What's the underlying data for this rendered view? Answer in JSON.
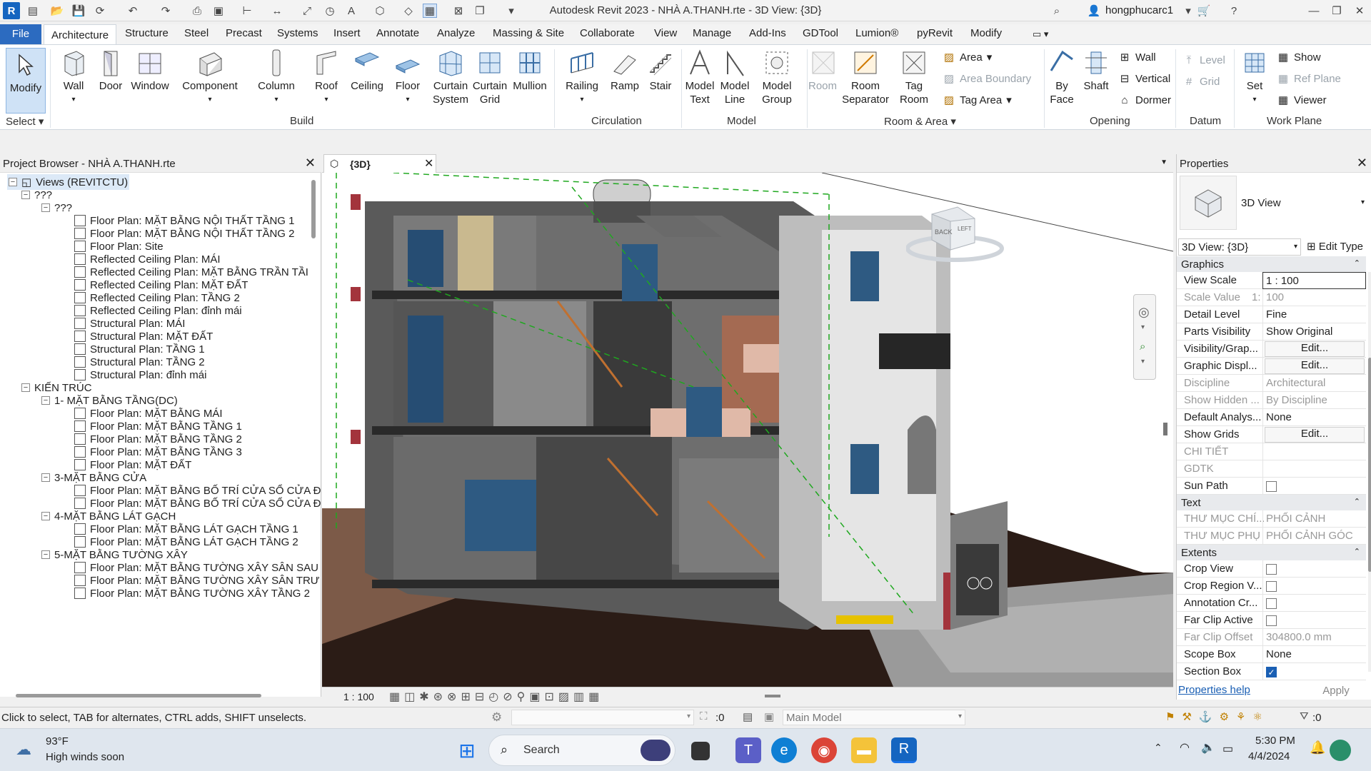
{
  "window": {
    "title": "Autodesk Revit 2023 - NHÀ A.THANH.rte - 3D View: {3D}",
    "user": "hongphucarc1",
    "logo": "R"
  },
  "menu_tabs": [
    "File",
    "Architecture",
    "Structure",
    "Steel",
    "Precast",
    "Systems",
    "Insert",
    "Annotate",
    "Analyze",
    "Massing & Site",
    "Collaborate",
    "View",
    "Manage",
    "Add-Ins",
    "GDTool",
    "Lumion®",
    "pyRevit",
    "Modify"
  ],
  "active_tab": "Architecture",
  "ribbon": {
    "select": {
      "modify": "Modify",
      "group": "Select"
    },
    "build": {
      "items": [
        "Wall",
        "Door",
        "Window",
        "Component",
        "Column",
        "Roof",
        "Ceiling",
        "Floor",
        "Curtain System",
        "Curtain Grid",
        "Mullion"
      ],
      "group": "Build"
    },
    "circulation": {
      "items": [
        "Railing",
        "Ramp",
        "Stair"
      ],
      "group": "Circulation"
    },
    "model": {
      "items": [
        "Model Text",
        "Model Line",
        "Model Group"
      ],
      "group": "Model"
    },
    "room_area": {
      "items": [
        "Room",
        "Room Separator",
        "Tag Room"
      ],
      "small": [
        "Area",
        "Area Boundary",
        "Tag Area"
      ],
      "group": "Room & Area"
    },
    "opening": {
      "items": [
        "By Face",
        "Shaft"
      ],
      "small": [
        "Wall",
        "Vertical",
        "Dormer"
      ],
      "group": "Opening"
    },
    "datum": {
      "small": [
        "Level",
        "Grid"
      ],
      "group": "Datum"
    },
    "work_plane": {
      "set": "Set",
      "small": [
        "Show",
        "Ref Plane",
        "Viewer"
      ],
      "group": "Work Plane"
    }
  },
  "project_browser": {
    "title": "Project Browser - NHÀ A.THANH.rte",
    "rows": [
      {
        "label": "Views (REVITCTU)",
        "type": "root"
      },
      {
        "label": "???",
        "type": "group"
      },
      {
        "label": "???",
        "type": "group2"
      },
      {
        "label": "Floor Plan: MẶT BẰNG NỘI THẤT TẦNG 1",
        "type": "view"
      },
      {
        "label": "Floor Plan: MẶT BẰNG NỘI THẤT TẦNG 2",
        "type": "view"
      },
      {
        "label": "Floor Plan: Site",
        "type": "view"
      },
      {
        "label": "Reflected Ceiling Plan: MÁI",
        "type": "view"
      },
      {
        "label": "Reflected Ceiling Plan: MẶT BẰNG TRẦN TẦI",
        "type": "view"
      },
      {
        "label": "Reflected Ceiling Plan: MẶT ĐẤT",
        "type": "view"
      },
      {
        "label": "Reflected Ceiling Plan: TẦNG 2",
        "type": "view"
      },
      {
        "label": "Reflected Ceiling Plan: đỉnh mái",
        "type": "view"
      },
      {
        "label": "Structural Plan: MÁI",
        "type": "view"
      },
      {
        "label": "Structural Plan: MẶT ĐẤT",
        "type": "view"
      },
      {
        "label": "Structural Plan: TẦNG 1",
        "type": "view"
      },
      {
        "label": "Structural Plan: TẦNG 2",
        "type": "view"
      },
      {
        "label": "Structural Plan: đỉnh mái",
        "type": "view"
      },
      {
        "label": "KIẾN TRÚC",
        "type": "group"
      },
      {
        "label": "1- MẶT BẰNG TẦNG(DC)",
        "type": "group2"
      },
      {
        "label": "Floor Plan: MẶT BẰNG MÁI",
        "type": "view"
      },
      {
        "label": "Floor Plan: MẶT BẰNG TẦNG 1",
        "type": "view"
      },
      {
        "label": "Floor Plan: MẶT BẰNG TẦNG 2",
        "type": "view"
      },
      {
        "label": "Floor Plan: MẶT BẰNG TẦNG 3",
        "type": "view"
      },
      {
        "label": "Floor Plan: MẶT ĐẤT",
        "type": "view"
      },
      {
        "label": "3-MẶT BẰNG CỬA",
        "type": "group2"
      },
      {
        "label": "Floor Plan: MẶT BẰNG BỐ TRÍ CỬA SỔ CỬA Đ",
        "type": "view"
      },
      {
        "label": "Floor Plan: MẶT BẰNG BỐ TRÍ CỬA SỔ CỬA Đ",
        "type": "view"
      },
      {
        "label": "4-MẶT BẰNG LÁT GẠCH",
        "type": "group2"
      },
      {
        "label": "Floor Plan: MẶT BẰNG LÁT GẠCH TẦNG 1",
        "type": "view"
      },
      {
        "label": "Floor Plan: MẶT BẰNG LÁT GẠCH TẦNG 2",
        "type": "view"
      },
      {
        "label": "5-MẶT BẰNG TƯỜNG XÂY",
        "type": "group2"
      },
      {
        "label": "Floor Plan: MẶT BẰNG TƯỜNG XÂY SÂN SAU",
        "type": "view"
      },
      {
        "label": "Floor Plan: MẶT BẰNG TƯỜNG XÂY SÂN TRƯ",
        "type": "view"
      },
      {
        "label": "Floor Plan: MẶT BẰNG TƯỜNG XÂY TẦNG 2",
        "type": "view"
      }
    ]
  },
  "view": {
    "tab_label": "{3D}",
    "scale": "1 : 100",
    "viewcube": {
      "back": "BACK",
      "left": "LEFT"
    }
  },
  "properties": {
    "title": "Properties",
    "type_name": "3D View",
    "selector": "3D View: {3D}",
    "edit_type": "Edit Type",
    "sections": {
      "graphics": "Graphics",
      "text": "Text",
      "extents": "Extents"
    },
    "graphics": [
      {
        "k": "View Scale",
        "v": "1 : 100"
      },
      {
        "k": "Scale Value",
        "v": "100",
        "prefix": "1:"
      },
      {
        "k": "Detail Level",
        "v": "Fine"
      },
      {
        "k": "Parts Visibility",
        "v": "Show Original"
      },
      {
        "k": "Visibility/Grap...",
        "v": "Edit..."
      },
      {
        "k": "Graphic Displ...",
        "v": "Edit..."
      },
      {
        "k": "Discipline",
        "v": "Architectural"
      },
      {
        "k": "Show Hidden ...",
        "v": "By Discipline"
      },
      {
        "k": "Default Analys...",
        "v": "None"
      },
      {
        "k": "Show Grids",
        "v": "Edit..."
      },
      {
        "k": "CHI TIẾT",
        "v": ""
      },
      {
        "k": "GDTK",
        "v": ""
      },
      {
        "k": "Sun Path",
        "v": "unchecked"
      }
    ],
    "text": [
      {
        "k": "THƯ MỤC CHÍ...",
        "v": "PHỐI CẢNH"
      },
      {
        "k": "THƯ MỤC PHỤ",
        "v": "PHỐI CẢNH GÓC"
      }
    ],
    "extents": [
      {
        "k": "Crop View",
        "v": "unchecked"
      },
      {
        "k": "Crop Region V...",
        "v": "unchecked"
      },
      {
        "k": "Annotation Cr...",
        "v": "unchecked"
      },
      {
        "k": "Far Clip Active",
        "v": "unchecked"
      },
      {
        "k": "Far Clip Offset",
        "v": "304800.0 mm"
      },
      {
        "k": "Scope Box",
        "v": "None"
      },
      {
        "k": "Section Box",
        "v": "checked"
      }
    ],
    "help": "Properties help",
    "apply": "Apply"
  },
  "status": {
    "hint": "Click to select, TAB for alternates, CTRL adds, SHIFT unselects.",
    "selection_count": ":0",
    "model": "Main Model",
    "filter_count": ":0"
  },
  "taskbar": {
    "weather_temp": "93°F",
    "weather_text": "High winds soon",
    "search": "Search",
    "time": "5:30 PM",
    "date": "4/4/2024"
  },
  "colors": {
    "accent": "#2c6bc0",
    "revit_blue": "#1565c0",
    "ribbon_bg": "#ffffff"
  }
}
